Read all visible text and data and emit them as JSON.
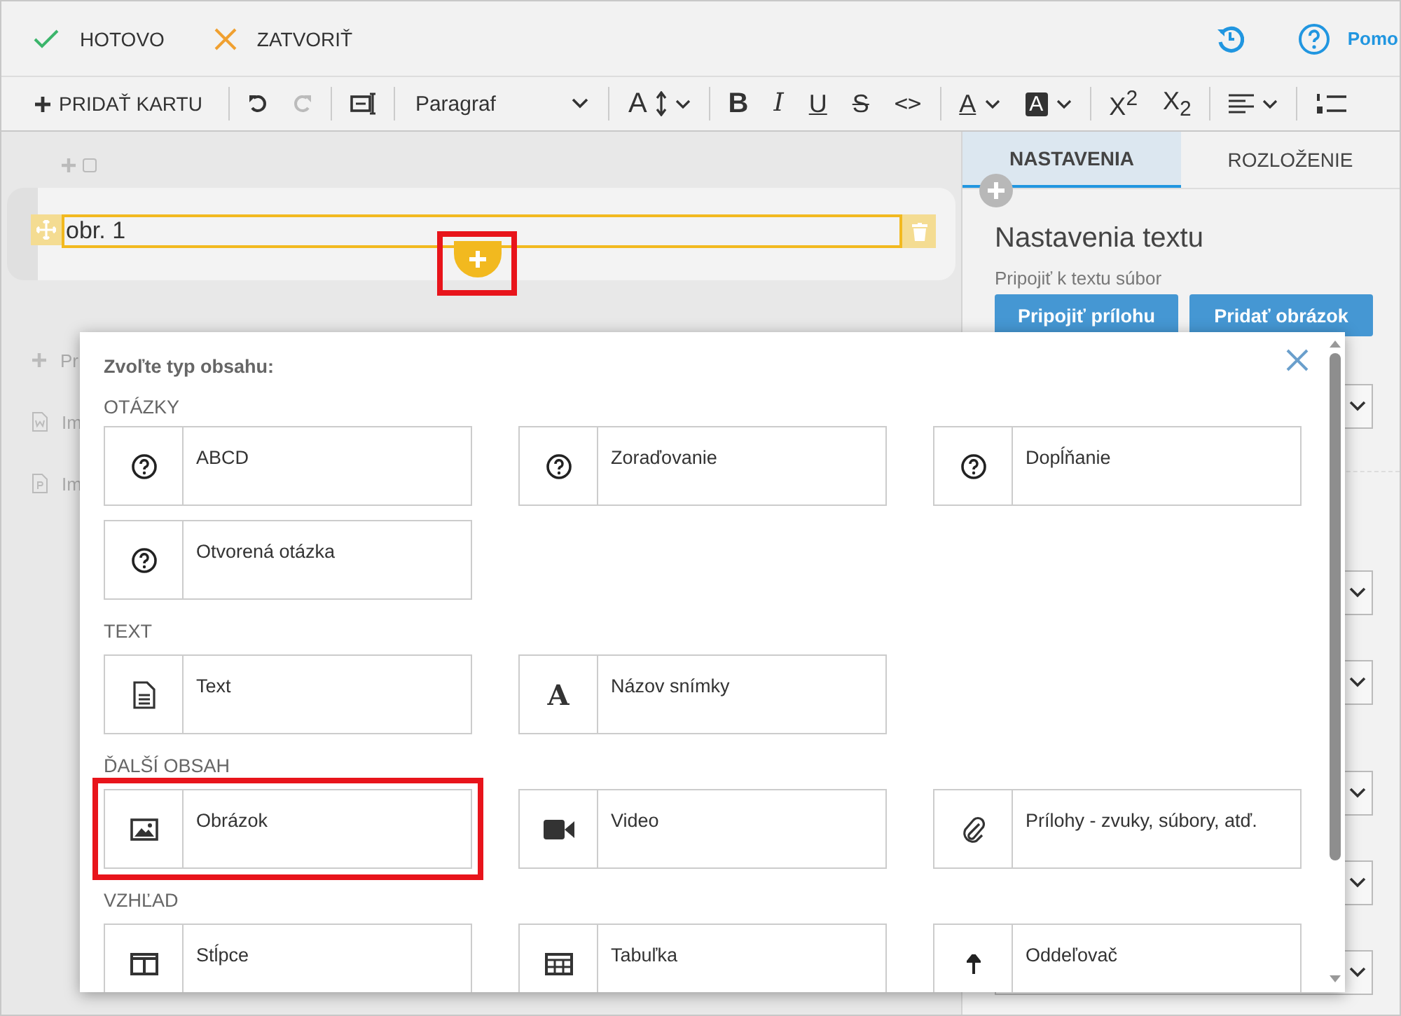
{
  "topbar": {
    "actions": [
      {
        "kind": "done",
        "label": "HOTOVO"
      },
      {
        "kind": "close",
        "label": "ZATVORIŤ"
      }
    ],
    "help": {
      "label": "Pomo"
    }
  },
  "toolbar": [
    {
      "kind": "add",
      "label": "PRIDAŤ KARTU",
      "disabled": false
    },
    {
      "kind": "sep"
    },
    {
      "kind": "undo",
      "disabled": false
    },
    {
      "kind": "redo",
      "disabled": true
    },
    {
      "kind": "sep"
    },
    {
      "kind": "textbox",
      "disabled": false
    },
    {
      "kind": "sep"
    },
    {
      "kind": "select",
      "label": "Paragraf"
    },
    {
      "kind": "sep"
    },
    {
      "kind": "fontsize",
      "label": "A",
      "disabled": false
    },
    {
      "kind": "sep"
    },
    {
      "kind": "bold",
      "label": "B",
      "disabled": false
    },
    {
      "kind": "italic",
      "label": "I",
      "disabled": false
    },
    {
      "kind": "underline",
      "label": "U",
      "disabled": false
    },
    {
      "kind": "strike",
      "label": "S",
      "disabled": false
    },
    {
      "kind": "code",
      "label": "<>",
      "disabled": false
    },
    {
      "kind": "sep"
    },
    {
      "kind": "color",
      "label": "A",
      "disabled": false
    },
    {
      "kind": "highlight",
      "label": "A",
      "disabled": false
    },
    {
      "kind": "sep"
    },
    {
      "kind": "superscript",
      "label": "X$^{2}$",
      "disabled": false
    },
    {
      "kind": "subscript",
      "label": "X$_{2}$",
      "disabled": false
    },
    {
      "kind": "sep"
    },
    {
      "kind": "align",
      "disabled": false
    },
    {
      "kind": "sep"
    },
    {
      "kind": "numlist",
      "disabled": false
    }
  ],
  "card": {
    "caption": "obr. 1",
    "add_button": {
      "highlighted": true
    }
  },
  "left_items": [
    {
      "kind": "add",
      "label": "Pr"
    },
    {
      "kind": "word",
      "label": "Im"
    },
    {
      "kind": "pdf",
      "label": "Im"
    }
  ],
  "panel": {
    "tabs": [
      {
        "label": "NASTAVENIA",
        "selected": true
      },
      {
        "label": "ROZLOŽENIE",
        "selected": false
      }
    ],
    "heading": "Nastavenia textu",
    "attach_label": "Pripojiť k textu súbor",
    "buttons": [
      "Pripojiť prílohu",
      "Pridať obrázok"
    ]
  },
  "dialog": {
    "title": "Zvoľte typ obsahu:",
    "sections": [
      {
        "title": "OTÁZKY",
        "options": [
          {
            "kind": "question",
            "label": "ABCD",
            "highlighted": false
          },
          {
            "kind": "question",
            "label": "Zoraďovanie",
            "highlighted": false
          },
          {
            "kind": "question",
            "label": "Dopĺňanie",
            "highlighted": false
          },
          {
            "kind": "question",
            "label": "Otvorená otázka",
            "highlighted": false
          }
        ]
      },
      {
        "title": "TEXT",
        "options": [
          {
            "kind": "doc",
            "label": "Text",
            "highlighted": false
          },
          {
            "kind": "glyph",
            "glyph": "A",
            "label": "Názov snímky",
            "highlighted": false
          }
        ]
      },
      {
        "title": "ĎALŠÍ OBSAH",
        "options": [
          {
            "kind": "image",
            "label": "Obrázok",
            "highlighted": true
          },
          {
            "kind": "video",
            "label": "Video",
            "highlighted": false
          },
          {
            "kind": "clip",
            "label": "Prílohy - zvuky, súbory, atď.",
            "highlighted": false
          }
        ]
      },
      {
        "title": "VZHĽAD",
        "options": [
          {
            "kind": "columns",
            "label": "Stĺpce",
            "highlighted": false
          },
          {
            "kind": "table",
            "label": "Tabuľka",
            "highlighted": false
          },
          {
            "kind": "arrowup",
            "label": "Oddeľovač",
            "highlighted": false
          }
        ]
      }
    ]
  }
}
